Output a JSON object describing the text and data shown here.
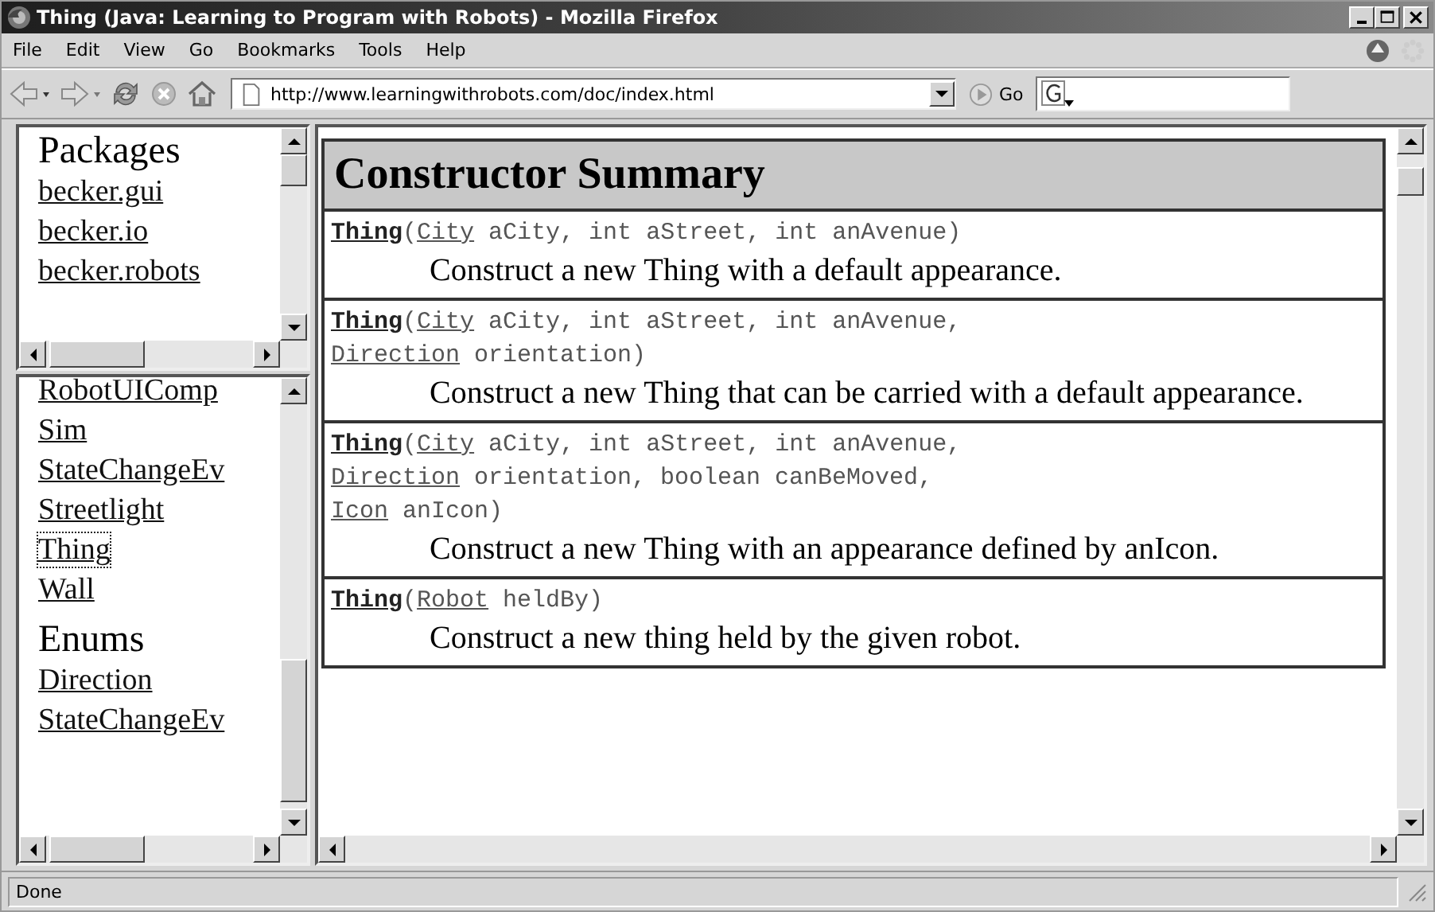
{
  "window": {
    "title": "Thing (Java: Learning to Program with Robots) - Mozilla Firefox"
  },
  "menu": [
    "File",
    "Edit",
    "View",
    "Go",
    "Bookmarks",
    "Tools",
    "Help"
  ],
  "toolbar": {
    "url": "http://www.learningwithrobots.com/doc/index.html",
    "go_label": "Go"
  },
  "packages_frame": {
    "heading": "Packages",
    "links": [
      "becker.gui",
      "becker.io",
      "becker.robots"
    ]
  },
  "classes_frame": {
    "sections": [
      {
        "links": [
          {
            "text": "RobotUIComp",
            "focused": false
          },
          {
            "text": "Sim",
            "focused": false
          },
          {
            "text": "StateChangeEv",
            "focused": false
          },
          {
            "text": "Streetlight",
            "focused": false
          },
          {
            "text": "Thing",
            "focused": true
          },
          {
            "text": "Wall",
            "focused": false
          }
        ]
      },
      {
        "heading": "Enums",
        "links": [
          {
            "text": "Direction",
            "focused": false
          },
          {
            "text": "StateChangeEv",
            "focused": false
          }
        ]
      }
    ]
  },
  "summary": {
    "title": "Constructor Summary",
    "rows": [
      {
        "signature": [
          [
            {
              "kind": "name",
              "text": "Thing"
            },
            {
              "kind": "code",
              "text": "("
            },
            {
              "kind": "type",
              "text": "City"
            },
            {
              "kind": "code",
              "text": " aCity, int aStreet, int anAvenue)"
            }
          ]
        ],
        "description": "Construct a new Thing with a default appearance."
      },
      {
        "signature": [
          [
            {
              "kind": "name",
              "text": "Thing"
            },
            {
              "kind": "code",
              "text": "("
            },
            {
              "kind": "type",
              "text": "City"
            },
            {
              "kind": "code",
              "text": " aCity, int aStreet, int anAvenue,"
            }
          ],
          [
            {
              "kind": "type",
              "text": "Direction"
            },
            {
              "kind": "code",
              "text": " orientation)"
            }
          ]
        ],
        "description": "Construct a new Thing that can be carried with a default appearance."
      },
      {
        "signature": [
          [
            {
              "kind": "name",
              "text": "Thing"
            },
            {
              "kind": "code",
              "text": "("
            },
            {
              "kind": "type",
              "text": "City"
            },
            {
              "kind": "code",
              "text": " aCity, int aStreet, int anAvenue,"
            }
          ],
          [
            {
              "kind": "type",
              "text": "Direction"
            },
            {
              "kind": "code",
              "text": " orientation, boolean canBeMoved,"
            }
          ],
          [
            {
              "kind": "type",
              "text": "Icon"
            },
            {
              "kind": "code",
              "text": " anIcon)"
            }
          ]
        ],
        "description": "Construct a new Thing with an appearance defined by anIcon."
      },
      {
        "signature": [
          [
            {
              "kind": "name",
              "text": "Thing"
            },
            {
              "kind": "code",
              "text": "("
            },
            {
              "kind": "type",
              "text": "Robot"
            },
            {
              "kind": "code",
              "text": " heldBy)"
            }
          ]
        ],
        "description": "Construct a new thing held by the given robot."
      }
    ]
  },
  "status_bar": {
    "text": "Done"
  }
}
